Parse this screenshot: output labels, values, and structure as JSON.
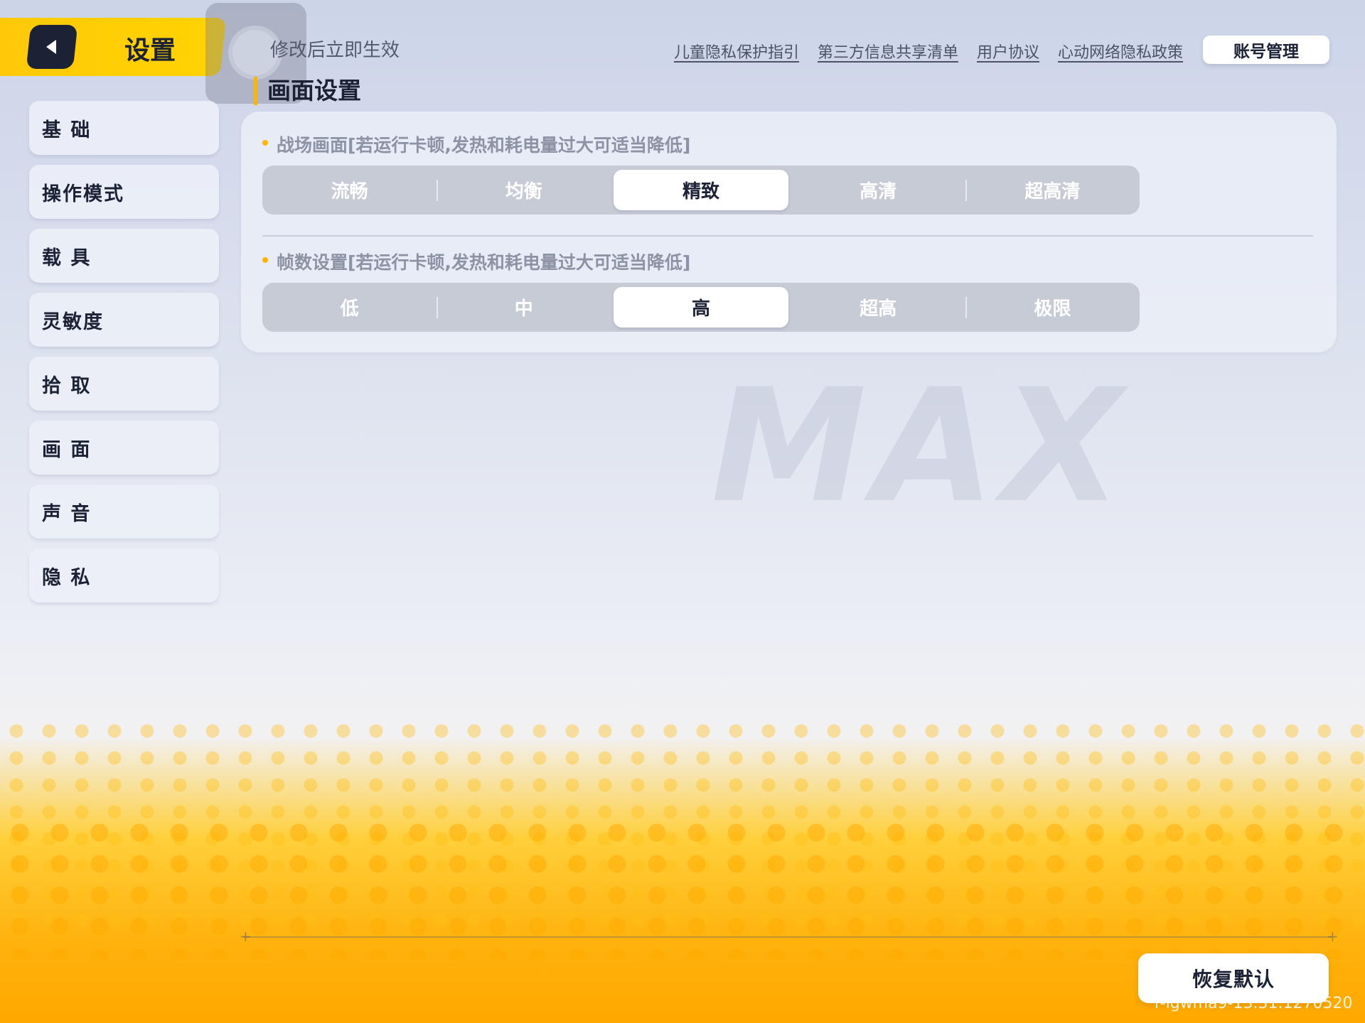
{
  "header": {
    "title": "设置",
    "notice": "修改后立即生效",
    "links": [
      "儿童隐私保护指引",
      "第三方信息共享清单",
      "用户协议",
      "心动网络隐私政策"
    ],
    "account_button": "账号管理"
  },
  "sidebar": {
    "items": [
      {
        "label": "基 础"
      },
      {
        "label": "操作模式"
      },
      {
        "label": "载 具"
      },
      {
        "label": "灵敏度"
      },
      {
        "label": "拾 取"
      },
      {
        "label": "画 面"
      },
      {
        "label": "声 音"
      },
      {
        "label": "隐 私"
      }
    ]
  },
  "main": {
    "section_title": "画面设置",
    "quality": {
      "label": "战场画面[若运行卡顿,发热和耗电量过大可适当降低]",
      "options": [
        "流畅",
        "均衡",
        "精致",
        "高清",
        "超高清"
      ],
      "selected": "精致"
    },
    "framerate": {
      "label": "帧数设置[若运行卡顿,发热和耗电量过大可适当降低]",
      "options": [
        "低",
        "中",
        "高",
        "超高",
        "极限"
      ],
      "selected": "高"
    }
  },
  "footer": {
    "reset_button": "恢复默认",
    "version": "r-lgwma9-13.31.1270520"
  },
  "colors": {
    "accent": "#ffc90a",
    "dark": "#1b2235",
    "segment_bg": "#c7cbd6"
  },
  "background": {
    "watermark": "MAX"
  }
}
